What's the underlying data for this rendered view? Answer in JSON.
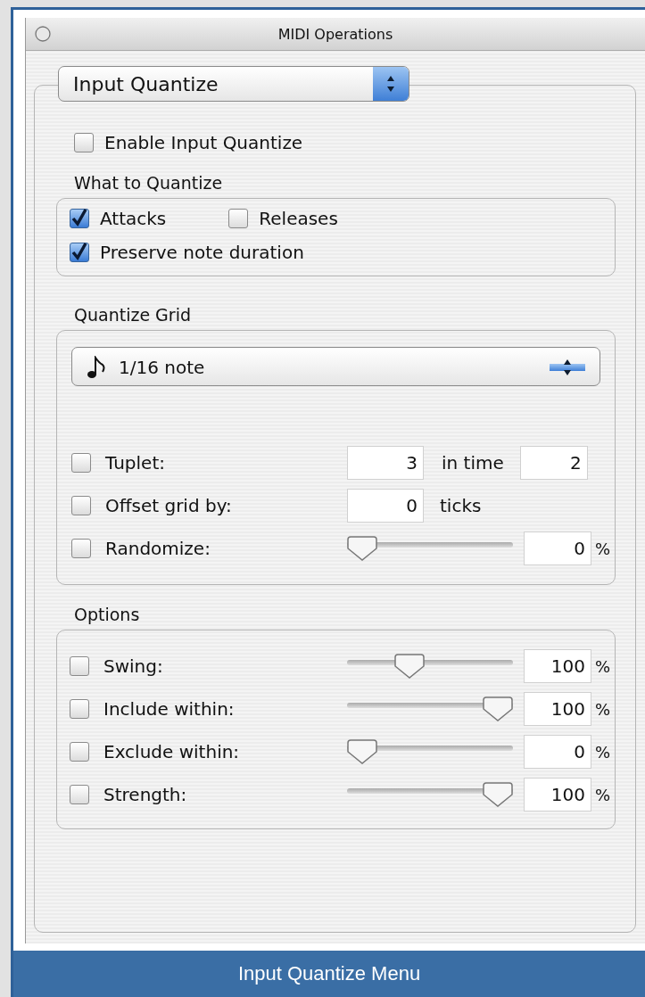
{
  "window": {
    "title": "MIDI Operations"
  },
  "mode_popup": {
    "value": "Input Quantize"
  },
  "enable": {
    "label": "Enable Input Quantize",
    "checked": false
  },
  "what_to_quantize": {
    "title": "What to Quantize",
    "options": [
      {
        "label": "Attacks",
        "checked": true
      },
      {
        "label": "Releases",
        "checked": false
      },
      {
        "label": "Preserve note duration",
        "checked": true
      }
    ]
  },
  "quantize_grid": {
    "title": "Quantize Grid",
    "grid_popup": {
      "value": "1/16 note"
    },
    "rows": [
      {
        "kind": "tuplet",
        "label": "Tuplet:",
        "checked": false,
        "value": "3",
        "middle": "in time",
        "value_2": "2"
      },
      {
        "kind": "field",
        "label": "Offset grid by:",
        "checked": false,
        "value": "0",
        "unit": "ticks"
      },
      {
        "kind": "slider",
        "label": "Randomize:",
        "checked": false,
        "level": 0,
        "value": "0",
        "unit": "%"
      }
    ]
  },
  "options": {
    "title": "Options",
    "rows": [
      {
        "kind": "slider",
        "label": "Swing:",
        "checked": false,
        "level": 0.35,
        "value": "100",
        "unit": "%"
      },
      {
        "kind": "slider",
        "label": "Include within:",
        "checked": false,
        "level": 1,
        "value": "100",
        "unit": "%"
      },
      {
        "kind": "slider",
        "label": "Exclude within:",
        "checked": false,
        "level": 0,
        "value": "0",
        "unit": "%"
      },
      {
        "kind": "slider",
        "label": "Strength:",
        "checked": false,
        "level": 1,
        "value": "100",
        "unit": "%"
      }
    ]
  },
  "caption": "Input Quantize Menu"
}
